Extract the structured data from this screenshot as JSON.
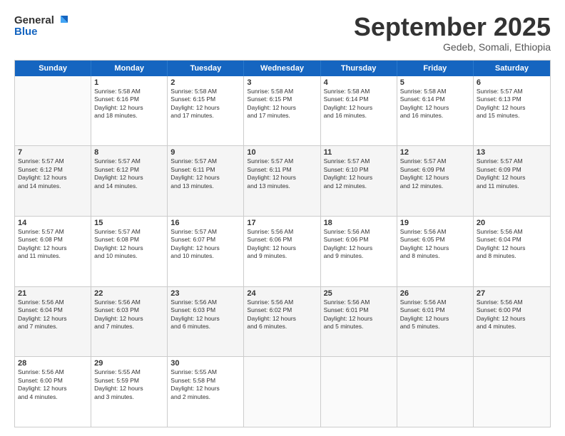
{
  "logo": {
    "general": "General",
    "blue": "Blue"
  },
  "title": "September 2025",
  "location": "Gedeb, Somali, Ethiopia",
  "days": [
    "Sunday",
    "Monday",
    "Tuesday",
    "Wednesday",
    "Thursday",
    "Friday",
    "Saturday"
  ],
  "weeks": [
    [
      {
        "day": "",
        "info": ""
      },
      {
        "day": "1",
        "info": "Sunrise: 5:58 AM\nSunset: 6:16 PM\nDaylight: 12 hours\nand 18 minutes."
      },
      {
        "day": "2",
        "info": "Sunrise: 5:58 AM\nSunset: 6:15 PM\nDaylight: 12 hours\nand 17 minutes."
      },
      {
        "day": "3",
        "info": "Sunrise: 5:58 AM\nSunset: 6:15 PM\nDaylight: 12 hours\nand 17 minutes."
      },
      {
        "day": "4",
        "info": "Sunrise: 5:58 AM\nSunset: 6:14 PM\nDaylight: 12 hours\nand 16 minutes."
      },
      {
        "day": "5",
        "info": "Sunrise: 5:58 AM\nSunset: 6:14 PM\nDaylight: 12 hours\nand 16 minutes."
      },
      {
        "day": "6",
        "info": "Sunrise: 5:57 AM\nSunset: 6:13 PM\nDaylight: 12 hours\nand 15 minutes."
      }
    ],
    [
      {
        "day": "7",
        "info": "Sunrise: 5:57 AM\nSunset: 6:12 PM\nDaylight: 12 hours\nand 14 minutes."
      },
      {
        "day": "8",
        "info": "Sunrise: 5:57 AM\nSunset: 6:12 PM\nDaylight: 12 hours\nand 14 minutes."
      },
      {
        "day": "9",
        "info": "Sunrise: 5:57 AM\nSunset: 6:11 PM\nDaylight: 12 hours\nand 13 minutes."
      },
      {
        "day": "10",
        "info": "Sunrise: 5:57 AM\nSunset: 6:11 PM\nDaylight: 12 hours\nand 13 minutes."
      },
      {
        "day": "11",
        "info": "Sunrise: 5:57 AM\nSunset: 6:10 PM\nDaylight: 12 hours\nand 12 minutes."
      },
      {
        "day": "12",
        "info": "Sunrise: 5:57 AM\nSunset: 6:09 PM\nDaylight: 12 hours\nand 12 minutes."
      },
      {
        "day": "13",
        "info": "Sunrise: 5:57 AM\nSunset: 6:09 PM\nDaylight: 12 hours\nand 11 minutes."
      }
    ],
    [
      {
        "day": "14",
        "info": "Sunrise: 5:57 AM\nSunset: 6:08 PM\nDaylight: 12 hours\nand 11 minutes."
      },
      {
        "day": "15",
        "info": "Sunrise: 5:57 AM\nSunset: 6:08 PM\nDaylight: 12 hours\nand 10 minutes."
      },
      {
        "day": "16",
        "info": "Sunrise: 5:57 AM\nSunset: 6:07 PM\nDaylight: 12 hours\nand 10 minutes."
      },
      {
        "day": "17",
        "info": "Sunrise: 5:56 AM\nSunset: 6:06 PM\nDaylight: 12 hours\nand 9 minutes."
      },
      {
        "day": "18",
        "info": "Sunrise: 5:56 AM\nSunset: 6:06 PM\nDaylight: 12 hours\nand 9 minutes."
      },
      {
        "day": "19",
        "info": "Sunrise: 5:56 AM\nSunset: 6:05 PM\nDaylight: 12 hours\nand 8 minutes."
      },
      {
        "day": "20",
        "info": "Sunrise: 5:56 AM\nSunset: 6:04 PM\nDaylight: 12 hours\nand 8 minutes."
      }
    ],
    [
      {
        "day": "21",
        "info": "Sunrise: 5:56 AM\nSunset: 6:04 PM\nDaylight: 12 hours\nand 7 minutes."
      },
      {
        "day": "22",
        "info": "Sunrise: 5:56 AM\nSunset: 6:03 PM\nDaylight: 12 hours\nand 7 minutes."
      },
      {
        "day": "23",
        "info": "Sunrise: 5:56 AM\nSunset: 6:03 PM\nDaylight: 12 hours\nand 6 minutes."
      },
      {
        "day": "24",
        "info": "Sunrise: 5:56 AM\nSunset: 6:02 PM\nDaylight: 12 hours\nand 6 minutes."
      },
      {
        "day": "25",
        "info": "Sunrise: 5:56 AM\nSunset: 6:01 PM\nDaylight: 12 hours\nand 5 minutes."
      },
      {
        "day": "26",
        "info": "Sunrise: 5:56 AM\nSunset: 6:01 PM\nDaylight: 12 hours\nand 5 minutes."
      },
      {
        "day": "27",
        "info": "Sunrise: 5:56 AM\nSunset: 6:00 PM\nDaylight: 12 hours\nand 4 minutes."
      }
    ],
    [
      {
        "day": "28",
        "info": "Sunrise: 5:56 AM\nSunset: 6:00 PM\nDaylight: 12 hours\nand 4 minutes."
      },
      {
        "day": "29",
        "info": "Sunrise: 5:55 AM\nSunset: 5:59 PM\nDaylight: 12 hours\nand 3 minutes."
      },
      {
        "day": "30",
        "info": "Sunrise: 5:55 AM\nSunset: 5:58 PM\nDaylight: 12 hours\nand 2 minutes."
      },
      {
        "day": "",
        "info": ""
      },
      {
        "day": "",
        "info": ""
      },
      {
        "day": "",
        "info": ""
      },
      {
        "day": "",
        "info": ""
      }
    ]
  ]
}
